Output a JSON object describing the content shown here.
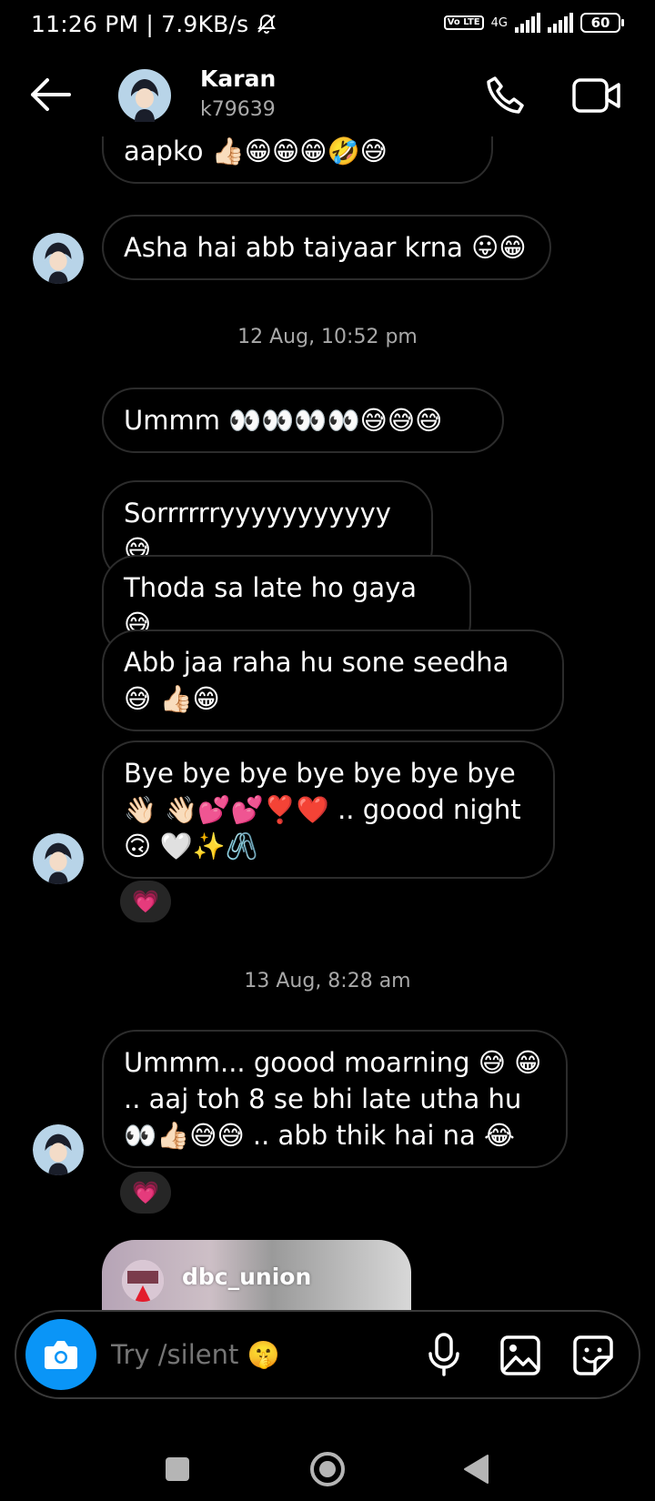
{
  "status_bar": {
    "time": "11:26 PM",
    "net_speed": "7.9KB/s",
    "network": "4G",
    "volte": "Vo LTE",
    "battery": "60"
  },
  "header": {
    "name": "Karan",
    "username": "k79639"
  },
  "messages": [
    {
      "text": "Ummm aaj n subo mil gya aapko 👍🏻😁😁😁🤣😅"
    },
    {
      "text": "Asha hai abb taiyaar krna 😛😁"
    },
    {
      "text": "Ummm 👀👀👀👀😅😅😅"
    },
    {
      "text": "Sorrrrrryyyyyyyyyyy 😅"
    },
    {
      "text": "Thoda sa late ho gaya 😅"
    },
    {
      "text": "Abb jaa raha hu sone seedha 😅 👍🏻😁"
    },
    {
      "text": "Bye bye bye bye bye bye bye 👋🏻 👋🏻💕💕❣️❤️ .. goood night 🙃 🤍✨🖇️"
    },
    {
      "text": "Ummm... goood moarning 😅 😁 .. aaj toh 8 se bhi late utha hu 👀👍🏻😅😅 .. abb thik hai na 😂"
    }
  ],
  "timestamps": [
    "12 Aug, 10:52 pm",
    "13 Aug, 8:28 am"
  ],
  "reactions": [
    "💗",
    "💗"
  ],
  "shared_post": {
    "username": "dbc_union"
  },
  "composer": {
    "placeholder": "Try /silent 🤫"
  },
  "colors": {
    "accent": "#0a95f7",
    "bubble_border": "#2c2c2c",
    "muted_text": "#a8a8a8"
  }
}
